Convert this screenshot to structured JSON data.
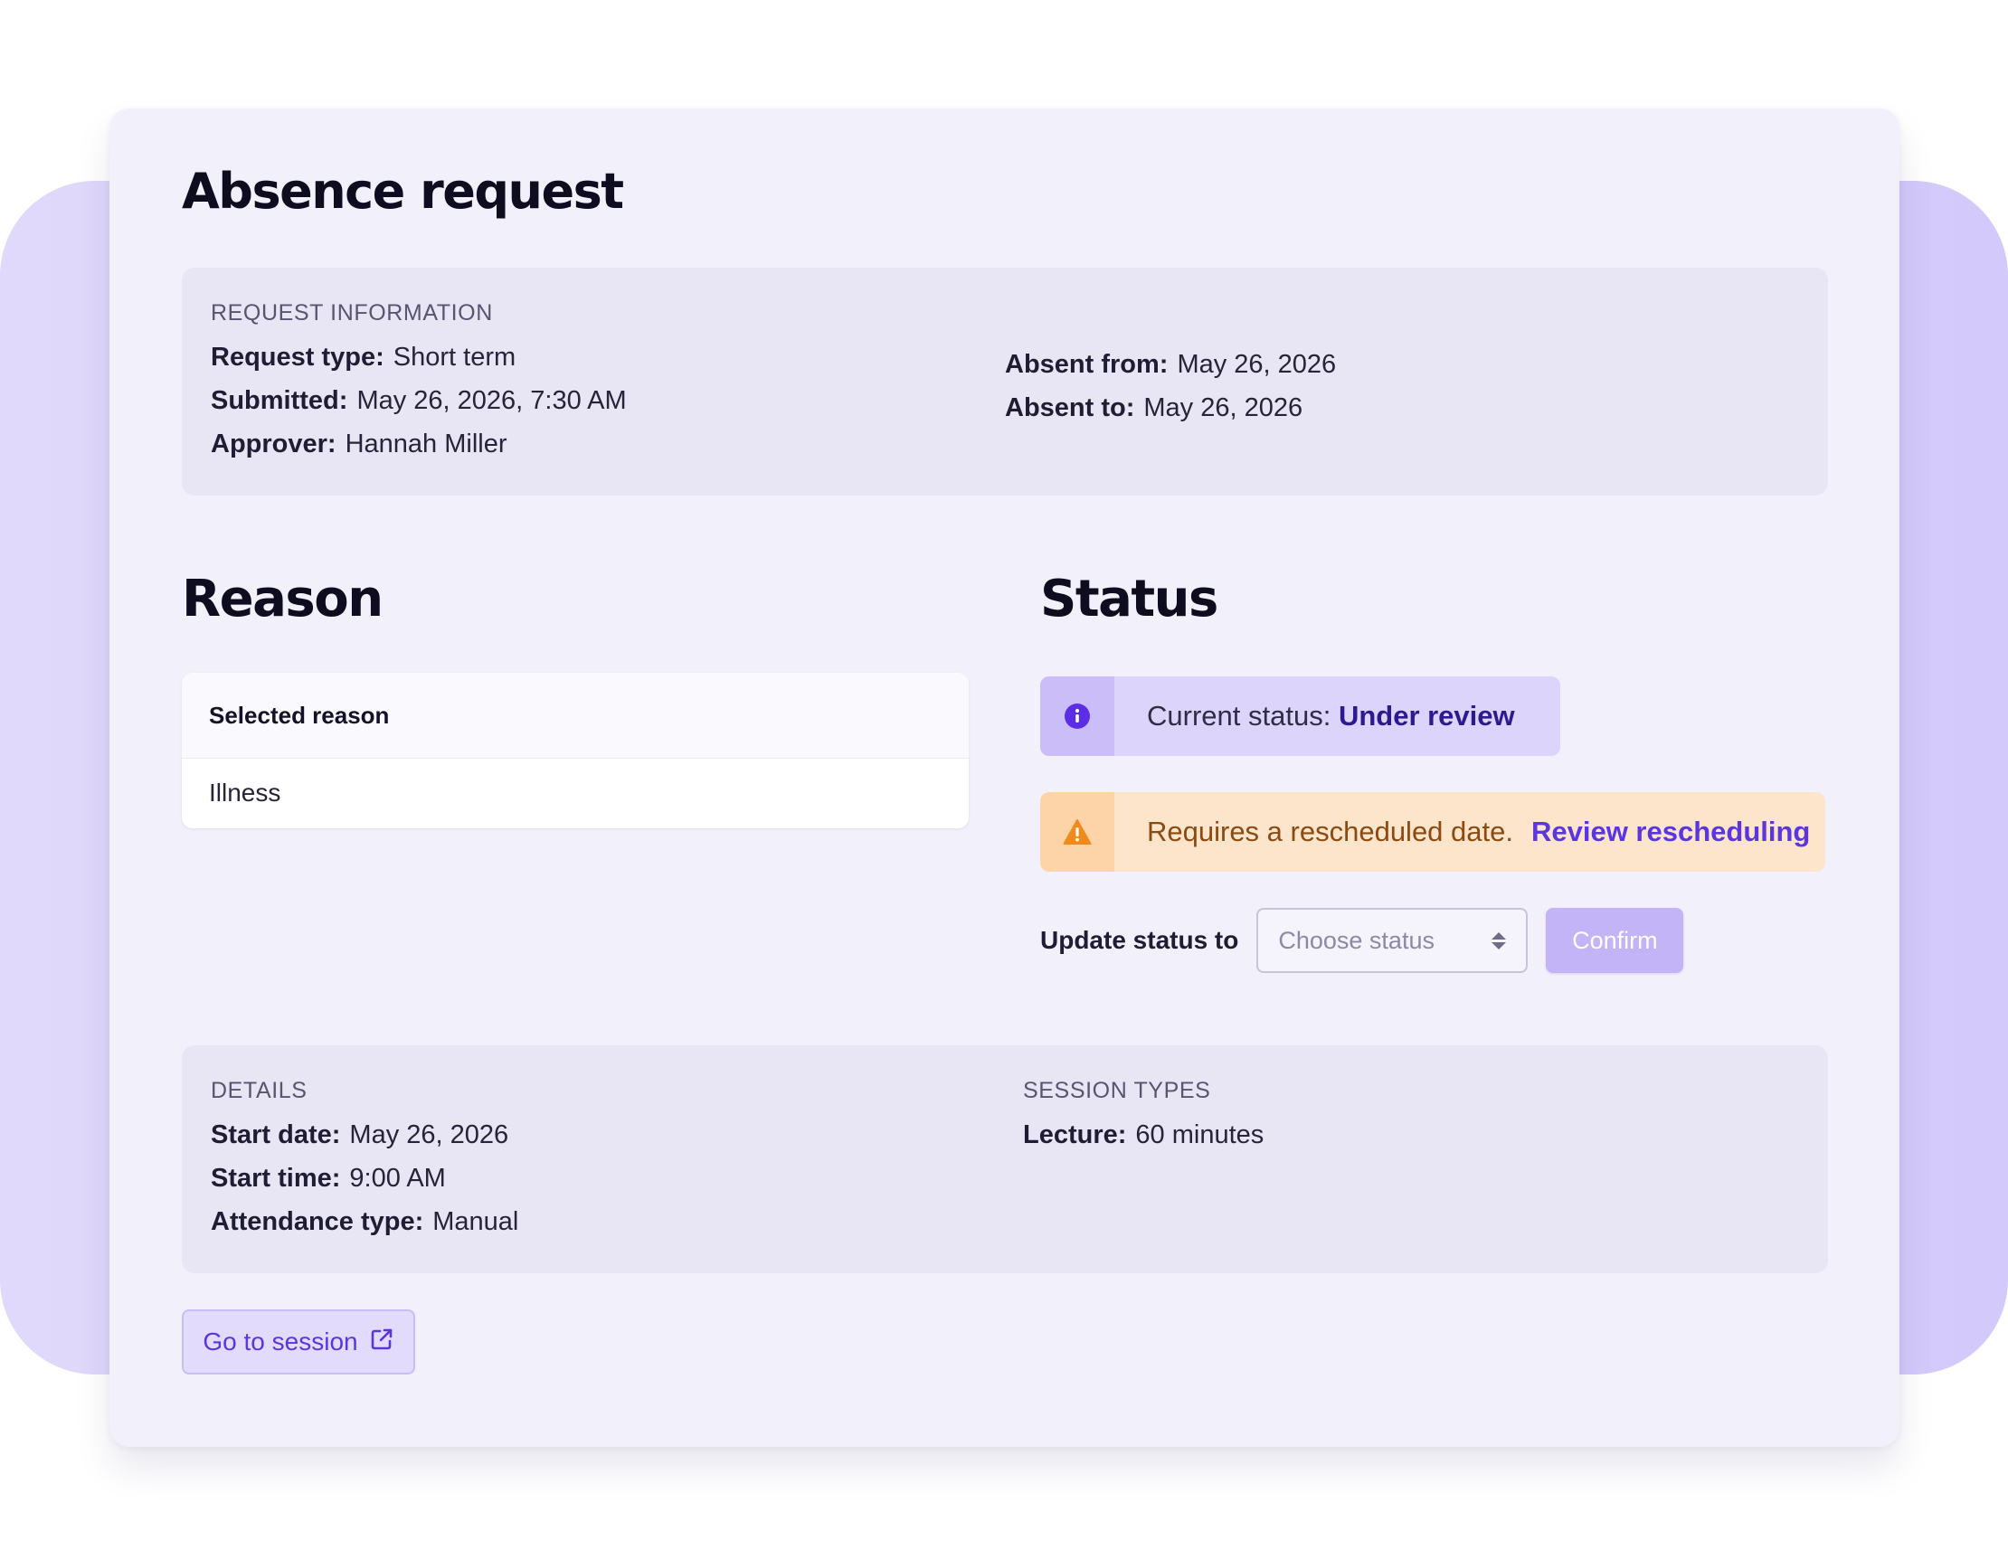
{
  "page": {
    "title": "Absence request"
  },
  "request_info": {
    "heading": "REQUEST INFORMATION",
    "left": [
      {
        "label": "Request type:",
        "value": "Short term"
      },
      {
        "label": "Submitted:",
        "value": "May 26, 2026, 7:30 AM"
      },
      {
        "label": "Approver:",
        "value": "Hannah Miller"
      }
    ],
    "right": [
      {
        "label": "Absent from:",
        "value": "May 26, 2026"
      },
      {
        "label": "Absent to:",
        "value": "May 26, 2026"
      }
    ]
  },
  "reason": {
    "title": "Reason",
    "card_header": "Selected reason",
    "selected": "Illness"
  },
  "status": {
    "title": "Status",
    "current_label": "Current status:",
    "current_value": "Under review",
    "warning_text": "Requires a rescheduled date.",
    "warning_link": "Review rescheduling",
    "update_label": "Update status to",
    "select_placeholder": "Choose status",
    "confirm_label": "Confirm"
  },
  "details": {
    "heading": "DETAILS",
    "rows": [
      {
        "label": "Start date:",
        "value": "May 26, 2026"
      },
      {
        "label": "Start time:",
        "value": "9:00 AM"
      },
      {
        "label": "Attendance type:",
        "value": "Manual"
      }
    ]
  },
  "session_types": {
    "heading": "SESSION TYPES",
    "rows": [
      {
        "label": "Lecture:",
        "value": "60 minutes"
      }
    ]
  },
  "actions": {
    "go_to_session": "Go to session"
  },
  "colors": {
    "accent": "#5a36e0",
    "status_bg": "#ddd4fb",
    "warning_bg": "#fde5cc",
    "warning_icon": "#f08a1c",
    "backdrop": "#d3c9fb"
  },
  "icons": {
    "status": "info-icon",
    "warning": "warning-icon",
    "select": "sort-arrows-icon",
    "session": "external-link-icon"
  }
}
